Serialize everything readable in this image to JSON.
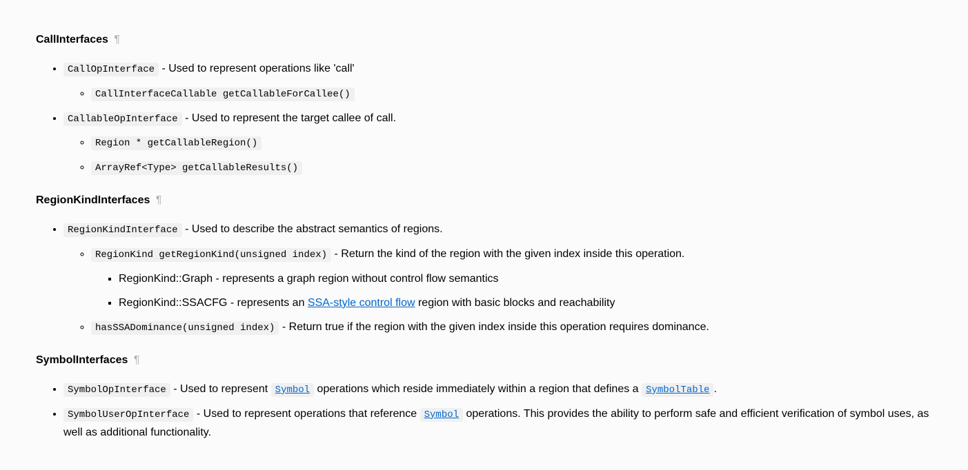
{
  "sections": {
    "call": {
      "heading": "CallInterfaces",
      "items": [
        {
          "code": "CallOpInterface",
          "desc": " - Used to represent operations like 'call'",
          "sub": [
            {
              "code": "CallInterfaceCallable getCallableForCallee()"
            }
          ]
        },
        {
          "code": "CallableOpInterface",
          "desc": " - Used to represent the target callee of call.",
          "sub": [
            {
              "code": "Region * getCallableRegion()"
            },
            {
              "code": "ArrayRef<Type> getCallableResults()"
            }
          ]
        }
      ]
    },
    "region": {
      "heading": "RegionKindInterfaces",
      "item1_code": "RegionKindInterface",
      "item1_desc": " - Used to describe the abstract semantics of regions.",
      "sub1_code": "RegionKind getRegionKind(unsigned index)",
      "sub1_desc": " - Return the kind of the region with the given index inside this operation.",
      "leaf1": "RegionKind::Graph - represents a graph region without control flow semantics",
      "leaf2_prefix": "RegionKind::SSACFG - represents an ",
      "leaf2_link": "SSA-style control flow",
      "leaf2_suffix": " region with basic blocks and reachability",
      "sub2_code": "hasSSADominance(unsigned index)",
      "sub2_desc": " - Return true if the region with the given index inside this operation requires dominance."
    },
    "symbol": {
      "heading": "SymbolInterfaces",
      "i1_code": "SymbolOpInterface",
      "i1_t1": " - Used to represent ",
      "i1_link1": "Symbol",
      "i1_t2": " operations which reside immediately within a region that defines a ",
      "i1_link2": "SymbolTable",
      "i1_t3": ".",
      "i2_code": "SymbolUserOpInterface",
      "i2_t1": " - Used to represent operations that reference ",
      "i2_link1": "Symbol",
      "i2_t2": " operations. This provides the ability to perform safe and efficient verification of symbol uses, as well as additional functionality."
    }
  },
  "pilcrow": "¶"
}
